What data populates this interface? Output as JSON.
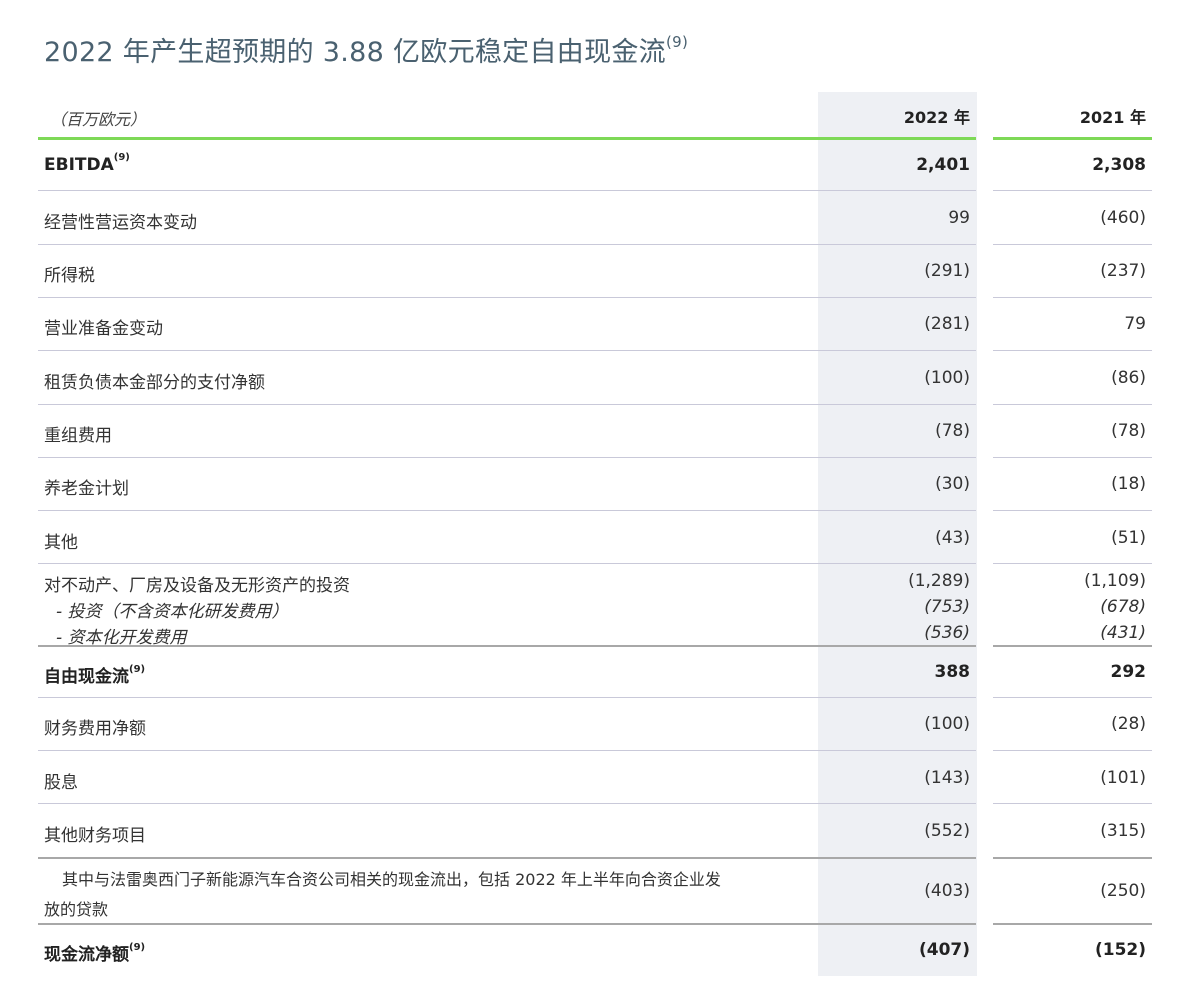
{
  "title": {
    "text": "2022 年产生超预期的 3.88 亿欧元稳定自由现金流",
    "note": "(9)"
  },
  "header": {
    "unit": "（百万欧元）",
    "col1": "2022 年",
    "col2": "2021 年"
  },
  "rows": [
    {
      "label": "EBITDA",
      "note": "(9)",
      "v2022": "2,401",
      "v2021": "2,308"
    },
    {
      "label": "经营性营运资本变动",
      "v2022": "99",
      "v2021": "(460)"
    },
    {
      "label": "所得税",
      "v2022": "(291)",
      "v2021": "(237)"
    },
    {
      "label": "营业准备金变动",
      "v2022": "(281)",
      "v2021": "79"
    },
    {
      "label": "租赁负债本金部分的支付净额",
      "v2022": "(100)",
      "v2021": "(86)"
    },
    {
      "label": "重组费用",
      "v2022": "(78)",
      "v2021": "(78)"
    },
    {
      "label": "养老金计划",
      "v2022": "(30)",
      "v2021": "(18)"
    },
    {
      "label": "其他",
      "v2022": "(43)",
      "v2021": "(51)"
    },
    {
      "label": "对不动产、厂房及设备及无形资产的投资",
      "v2022": "(1,289)",
      "v2021": "(1,109)"
    },
    {
      "label": "- 投资（不含资本化研发费用）",
      "v2022": "(753)",
      "v2021": "(678)"
    },
    {
      "label": "- 资本化开发费用",
      "v2022": "(536)",
      "v2021": "(431)"
    },
    {
      "label": "自由现金流",
      "note": "(9)",
      "v2022": "388",
      "v2021": "292"
    },
    {
      "label": "财务费用净额",
      "v2022": "(100)",
      "v2021": "(28)"
    },
    {
      "label": "股息",
      "v2022": "(143)",
      "v2021": "(101)"
    },
    {
      "label": "其他财务项目",
      "v2022": "(552)",
      "v2021": "(315)"
    },
    {
      "label_line1": "其中与法雷奥西门子新能源汽车合资公司相关的现金流出，包括 2022 年上半年向合资企业发",
      "label_line2": "放的贷款",
      "v2022": "(403)",
      "v2021": "(250)"
    },
    {
      "label": "现金流净额",
      "note": "(9)",
      "v2022": "(407)",
      "v2021": "(152)"
    }
  ]
}
